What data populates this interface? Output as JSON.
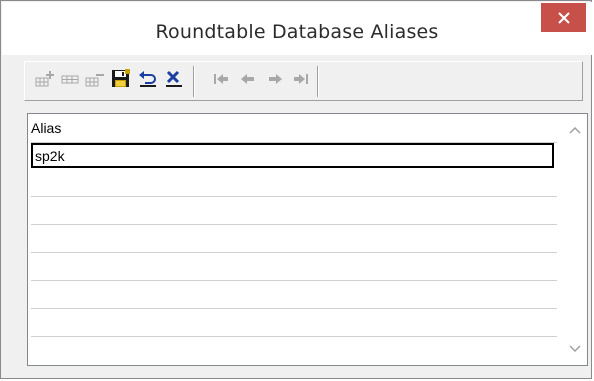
{
  "window": {
    "title": "Roundtable Database Aliases",
    "close_icon": "close-icon"
  },
  "toolbar": {
    "buttons": [
      {
        "name": "add-record-icon",
        "enabled": false
      },
      {
        "name": "edit-record-icon",
        "enabled": false
      },
      {
        "name": "delete-record-icon",
        "enabled": false
      },
      {
        "name": "save-icon",
        "enabled": true
      },
      {
        "name": "undo-icon",
        "enabled": true
      },
      {
        "name": "cancel-icon",
        "enabled": true
      },
      {
        "name": "first-record-icon",
        "enabled": false
      },
      {
        "name": "prior-record-icon",
        "enabled": false
      },
      {
        "name": "next-record-icon",
        "enabled": false
      },
      {
        "name": "last-record-icon",
        "enabled": false
      }
    ]
  },
  "grid": {
    "column_header": "Alias",
    "rows": [
      "sp2k"
    ]
  },
  "colors": {
    "close_button": "#c7504a",
    "disabled_icon": "#a8a8a8",
    "enabled_icon": "#1a1a1a"
  }
}
